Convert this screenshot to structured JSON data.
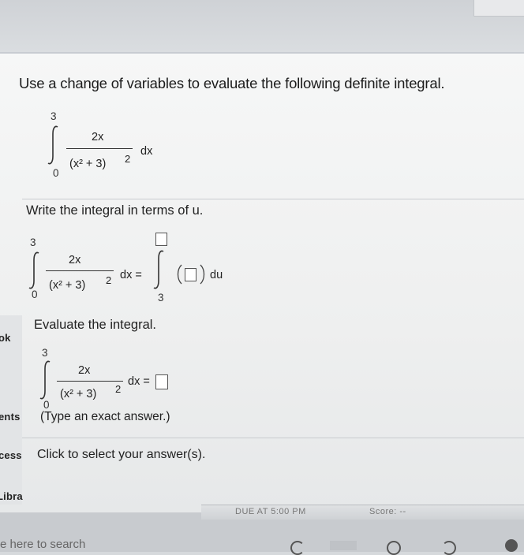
{
  "prompt": "Use a change of variables to evaluate the following definite integral.",
  "integral_display": {
    "upper": "3",
    "lower": "0",
    "numerator": "2x",
    "denominator": "(x² + 3)",
    "exponent": "2",
    "dx": "dx"
  },
  "part1": {
    "instruction": "Write the integral in terms of u.",
    "upper": "3",
    "lower": "0",
    "numerator": "2x",
    "denominator": "(x² + 3)",
    "exponent": "2",
    "dx_eq": "dx =",
    "rhs_lower": "3",
    "du": "du"
  },
  "part2": {
    "instruction": "Evaluate the integral.",
    "upper": "3",
    "lower": "0",
    "numerator": "2x",
    "denominator": "(x² + 3)",
    "exponent": "2",
    "dx_eq": "dx =",
    "hint": "(Type an exact answer.)"
  },
  "click_prompt": "Click to select your answer(s).",
  "side_labels": {
    "book": "ok",
    "contents": "ents",
    "access": "cess",
    "library": "Libra"
  },
  "footer": {
    "due": "DUE AT 5:00 PM",
    "score": "Score: --",
    "search": "e here to search"
  }
}
